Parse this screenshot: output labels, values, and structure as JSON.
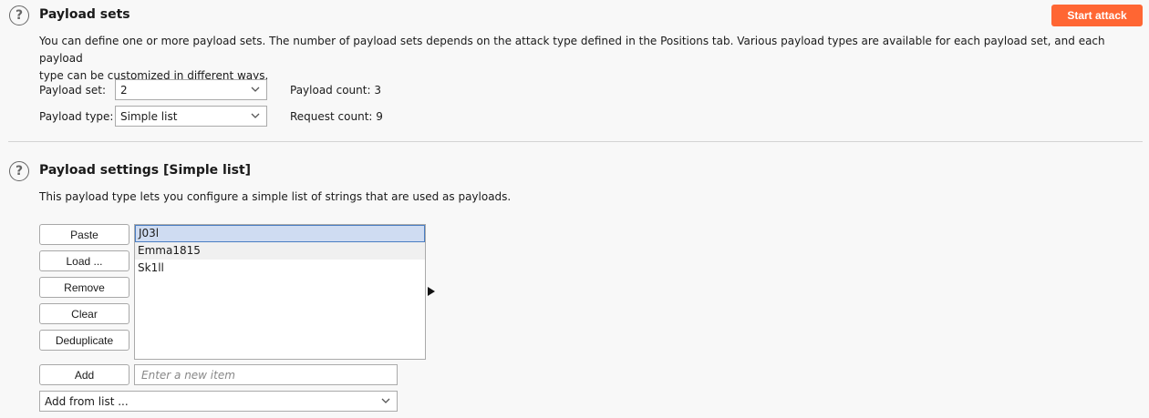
{
  "payload_sets": {
    "title": "Payload sets",
    "start_attack_label": "Start attack",
    "description_line1": "You can define one or more payload sets. The number of payload sets depends on the attack type defined in the Positions tab. Various payload types are available for each payload set, and each payload",
    "description_line2": "type can be customized in different ways.",
    "payload_set_label": "Payload set:",
    "payload_set_value": "2",
    "payload_type_label": "Payload type:",
    "payload_type_value": "Simple list",
    "payload_count_label": "Payload count:",
    "payload_count_value": "3",
    "request_count_label": "Request count:",
    "request_count_value": "9"
  },
  "payload_settings": {
    "title": "Payload settings [Simple list]",
    "description": "This payload type lets you configure a simple list of strings that are used as payloads.",
    "buttons": {
      "paste": "Paste",
      "load": "Load ...",
      "remove": "Remove",
      "clear": "Clear",
      "deduplicate": "Deduplicate",
      "add": "Add"
    },
    "items": [
      "J03l",
      "Emma1815",
      "Sk1ll"
    ],
    "new_item_placeholder": "Enter a new item",
    "add_from_list_value": "Add from list ..."
  },
  "icons": {
    "help": "help-icon",
    "dropdown": "chevron-down-icon",
    "expand": "caret-right-icon"
  },
  "colors": {
    "accent": "#ff6633",
    "selection": "#cfdcf2"
  }
}
